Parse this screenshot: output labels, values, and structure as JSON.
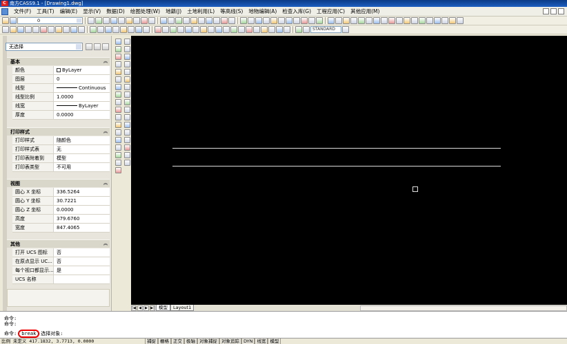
{
  "window": {
    "title": "南方CASS9.1 - [Drawing1.dwg]",
    "app_icon_letter": "C"
  },
  "menu": [
    "文件(F)",
    "工具(T)",
    "编辑(E)",
    "显示(V)",
    "数据(D)",
    "绘图处理(W)",
    "地籍(J)",
    "土地利用(L)",
    "等高线(S)",
    "地物编辑(A)",
    "检查入库(G)",
    "工程应用(C)",
    "其他应用(M)"
  ],
  "toolbar": {
    "layer_value": "0",
    "text_style": "STANDARD"
  },
  "properties": {
    "selection": "无选择",
    "sections": [
      {
        "title": "基本",
        "rows": [
          {
            "key": "颜色",
            "value": "ByLayer",
            "swatch": true
          },
          {
            "key": "图层",
            "value": "0"
          },
          {
            "key": "线型",
            "value": "Continuous",
            "line": true
          },
          {
            "key": "线型比例",
            "value": "1.0000"
          },
          {
            "key": "线宽",
            "value": "ByLayer",
            "line": true
          },
          {
            "key": "厚度",
            "value": "0.0000"
          }
        ]
      },
      {
        "title": "打印样式",
        "rows": [
          {
            "key": "打印样式",
            "value": "随颜色"
          },
          {
            "key": "打印样式表",
            "value": "无"
          },
          {
            "key": "打印表附着到",
            "value": "模型"
          },
          {
            "key": "打印表类型",
            "value": "不可用"
          }
        ]
      },
      {
        "title": "视图",
        "rows": [
          {
            "key": "圆心 X 坐标",
            "value": "336.5264"
          },
          {
            "key": "圆心 Y 坐标",
            "value": "30.7221"
          },
          {
            "key": "圆心 Z 坐标",
            "value": "0.0000"
          },
          {
            "key": "高度",
            "value": "379.6760"
          },
          {
            "key": "宽度",
            "value": "847.4065"
          }
        ]
      },
      {
        "title": "其他",
        "rows": [
          {
            "key": "打开 UCS 图标",
            "value": "否"
          },
          {
            "key": "在原点显示 UC...",
            "value": "否"
          },
          {
            "key": "每个视口都显示...",
            "value": "是"
          },
          {
            "key": "UCS 名称",
            "value": ""
          }
        ]
      }
    ]
  },
  "layout_tabs": [
    "模型",
    "Layout1"
  ],
  "command": {
    "history": [
      "命令:",
      "命令:"
    ],
    "prompt": "命令:",
    "typed": "break",
    "message": "选择对象:"
  },
  "status": {
    "left": "比例  未定义  417.1832, 3.7713, 0.0000",
    "buttons": [
      "捕捉",
      "栅格",
      "正交",
      "极轴",
      "对象捕捉",
      "对象追踪",
      "DYN",
      "线宽",
      "模型"
    ]
  },
  "colors": {
    "canvas": "#000000",
    "title_bar": "#0a3a86",
    "highlight_circle": "#e00000"
  }
}
